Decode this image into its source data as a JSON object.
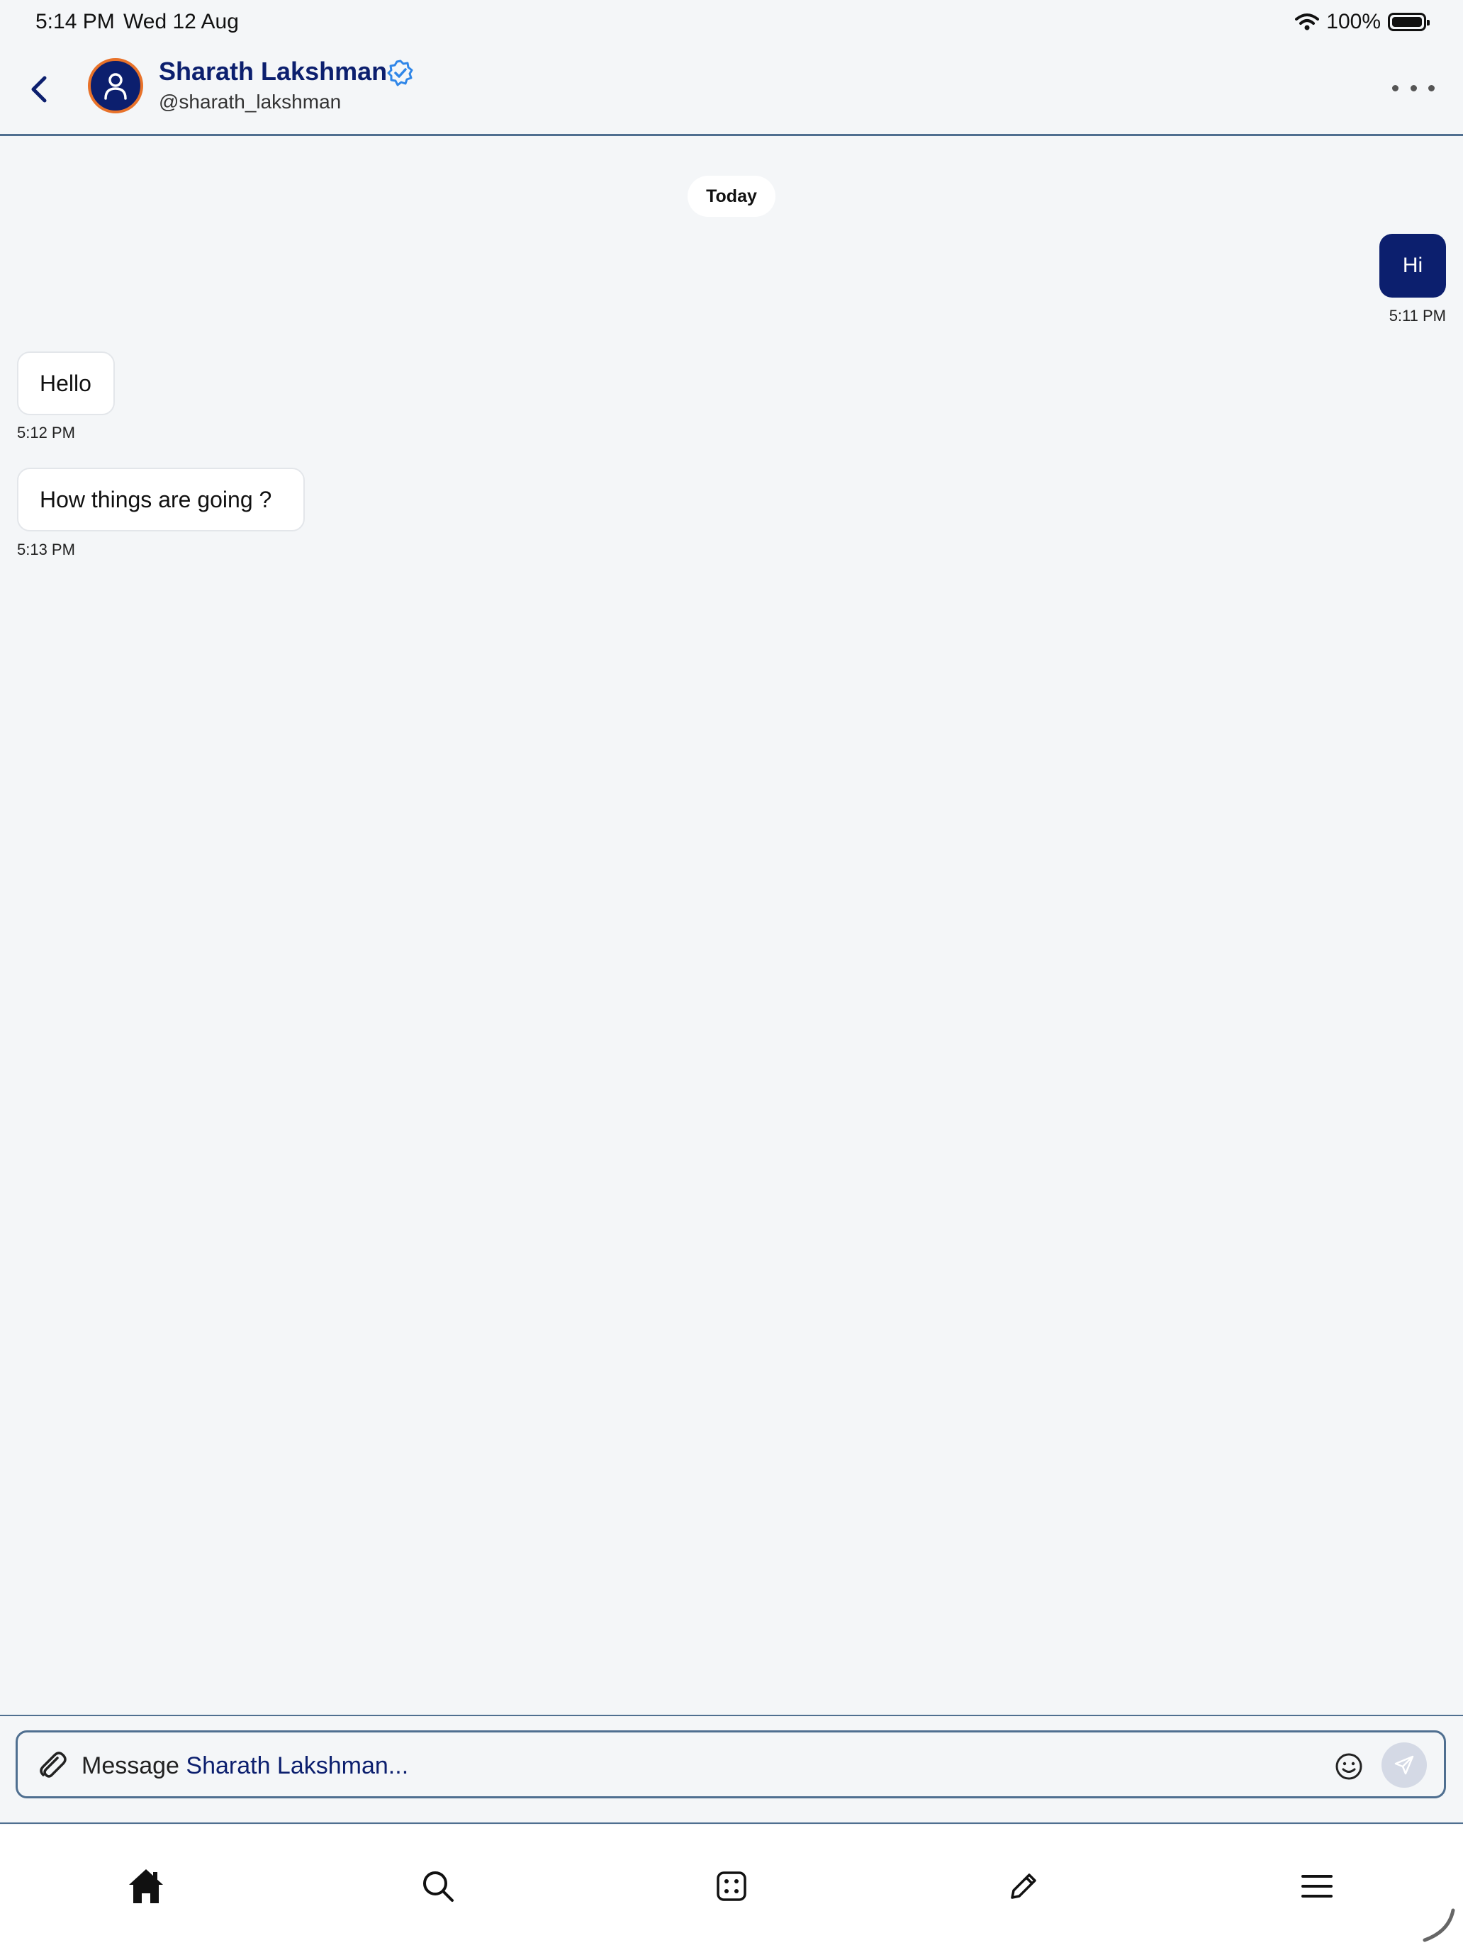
{
  "status_bar": {
    "time": "5:14 PM",
    "date": "Wed 12 Aug",
    "battery": "100%"
  },
  "header": {
    "back_icon": "chevron-left-icon",
    "contact_name": "Sharath Lakshman",
    "contact_handle": "@sharath_lakshman",
    "verified_icon": "verified-badge-icon",
    "more_icon": "more-horizontal-icon"
  },
  "conversation": {
    "date_divider": "Today",
    "messages": [
      {
        "direction": "outgoing",
        "text": "Hi",
        "time": "5:11 PM"
      },
      {
        "direction": "incoming",
        "text": "Hello",
        "time": "5:12 PM"
      },
      {
        "direction": "incoming",
        "text": "How things are going ?",
        "time": "5:13 PM"
      }
    ]
  },
  "composer": {
    "placeholder_prefix": "Message ",
    "placeholder_name": "Sharath Lakshman...",
    "attach_icon": "paperclip-icon",
    "emoji_icon": "smiley-icon",
    "send_icon": "send-icon"
  },
  "bottom_nav": {
    "items": [
      "home-icon",
      "search-icon",
      "apps-icon",
      "compose-icon",
      "menu-icon"
    ]
  },
  "colors": {
    "brand": "#0c1f6e",
    "avatar_ring": "#e8722a",
    "verified": "#2f86e8",
    "divider": "#4f6f90",
    "background": "#f4f6f8"
  }
}
